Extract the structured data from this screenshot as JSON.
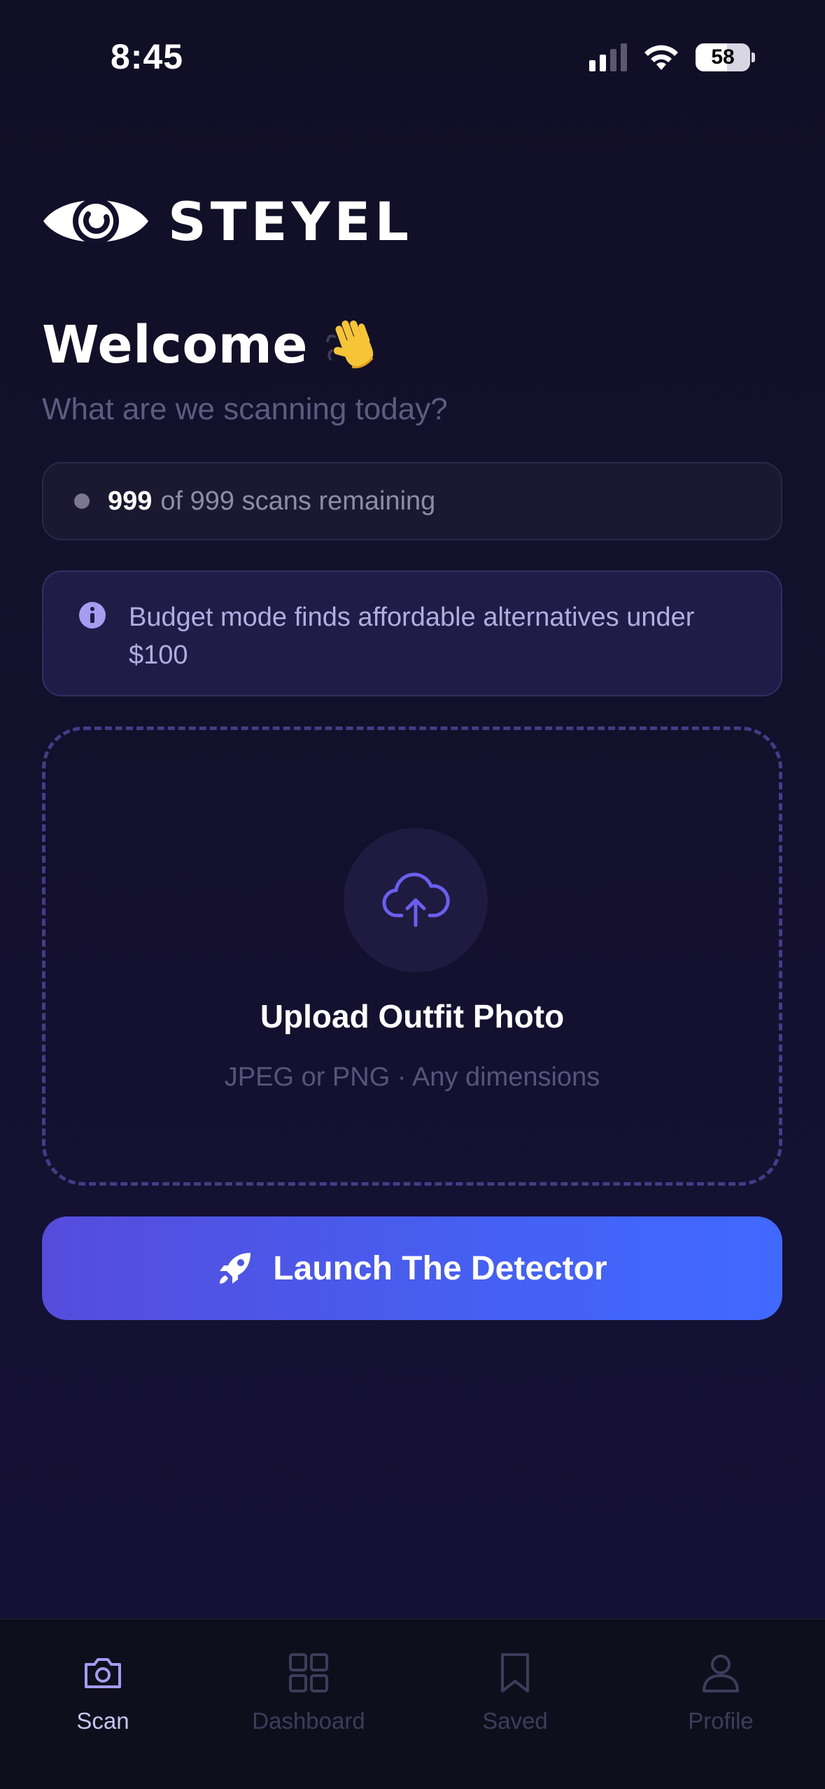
{
  "status_bar": {
    "time": "8:45",
    "battery": "58",
    "battery_level": 0.58,
    "signal_bars_active": 2,
    "icons": [
      "cellular-signal-icon",
      "wifi-icon",
      "battery-icon"
    ]
  },
  "brand": {
    "name": "STEYEL",
    "logo_icon": "eye-logo-icon"
  },
  "welcome": {
    "title": "Welcome",
    "emoji_icon": "waving-hand-icon",
    "subtitle": "What are we scanning today?"
  },
  "scans": {
    "count": "999",
    "text": "of 999 scans remaining"
  },
  "info": {
    "icon": "info-icon",
    "text": "Budget mode finds affordable alternatives under $100"
  },
  "upload": {
    "icon": "cloud-upload-icon",
    "title": "Upload Outfit Photo",
    "hint": "JPEG or PNG · Any dimensions"
  },
  "launch": {
    "icon": "rocket-icon",
    "label": "Launch The Detector"
  },
  "tabs": [
    {
      "label": "Scan",
      "icon": "camera-icon",
      "active": true
    },
    {
      "label": "Dashboard",
      "icon": "grid-icon",
      "active": false
    },
    {
      "label": "Saved",
      "icon": "bookmark-icon",
      "active": false
    },
    {
      "label": "Profile",
      "icon": "person-icon",
      "active": false
    }
  ],
  "colors": {
    "background": "#13102d",
    "accent": "#5b50e8",
    "accent_blue": "#4169ff",
    "muted_text": "#5f5b80",
    "info_text": "#b3acdf",
    "tab_active": "#c9c3f2",
    "tab_inactive": "#3f3b5b"
  }
}
